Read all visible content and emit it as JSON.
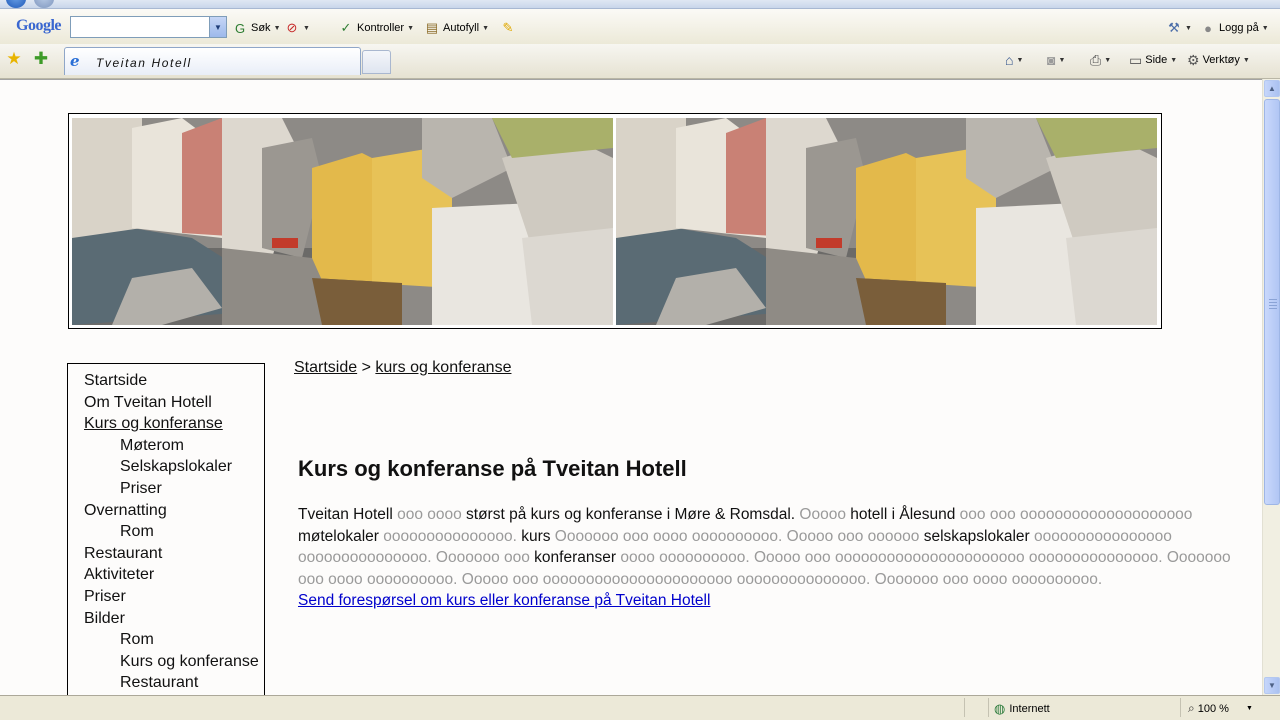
{
  "browser": {
    "google_logo": "Google",
    "google_toolbar": {
      "search_value": "",
      "search_label": "Søk",
      "check_label": "Kontroller",
      "autofill_label": "Autofyll",
      "login_label": "Logg på"
    },
    "tab": {
      "title": "Tveitan Hotell"
    },
    "command_bar": {
      "page_label": "Side",
      "tools_label": "Verktøy"
    },
    "status": {
      "zone": "Internett",
      "zoom": "100 %"
    }
  },
  "site": {
    "nav": [
      {
        "label": "Startside",
        "level": 1,
        "current": false
      },
      {
        "label": "Om Tveitan Hotell",
        "level": 1,
        "current": false
      },
      {
        "label": "Kurs og konferanse",
        "level": 1,
        "current": true
      },
      {
        "label": "Møterom",
        "level": 2,
        "current": false
      },
      {
        "label": "Selskapslokaler",
        "level": 2,
        "current": false
      },
      {
        "label": "Priser",
        "level": 2,
        "current": false
      },
      {
        "label": "Overnatting",
        "level": 1,
        "current": false
      },
      {
        "label": "Rom",
        "level": 2,
        "current": false
      },
      {
        "label": "Restaurant",
        "level": 1,
        "current": false
      },
      {
        "label": "Aktiviteter",
        "level": 1,
        "current": false
      },
      {
        "label": "Priser",
        "level": 1,
        "current": false
      },
      {
        "label": "Bilder",
        "level": 1,
        "current": false
      },
      {
        "label": "Rom",
        "level": 2,
        "current": false
      },
      {
        "label": "Kurs og konferanse",
        "level": 2,
        "current": false
      },
      {
        "label": "Restaurant",
        "level": 2,
        "current": false
      }
    ],
    "breadcrumb": {
      "home": "Startside",
      "separator": ">",
      "current": "kurs og konferanse"
    },
    "title": "Kurs og konferanse på Tveitan Hotell",
    "paragraph": [
      {
        "text": "Tveitan Hotell",
        "filler": false
      },
      {
        "text": " ooo oooo ",
        "filler": true
      },
      {
        "text": "størst på kurs og konferanse i Møre & Romsdal.",
        "filler": false
      },
      {
        "text": " Ooooo ",
        "filler": true
      },
      {
        "text": "hotell i Ålesund",
        "filler": false
      },
      {
        "text": " ooo ooo oooooooooooooooooooo ",
        "filler": true
      },
      {
        "text": "møtelokaler",
        "filler": false
      },
      {
        "text": " ooooooooooooooo. ",
        "filler": true
      },
      {
        "text": "kurs",
        "filler": false
      },
      {
        "text": " Ooooooo ooo oooo oooooooooo. Ooooo ooo oooooo ",
        "filler": true
      },
      {
        "text": "selskapslokaler",
        "filler": false
      },
      {
        "text": " oooooooooooooooo ooooooooooooooo. Ooooooo ooo ",
        "filler": true
      },
      {
        "text": "konferanser",
        "filler": false
      },
      {
        "text": " oooo oooooooooo. Ooooo ooo oooooooooooooooooooooo ooooooooooooooo. Ooooooo ooo oooo oooooooooo. Ooooo ooo oooooooooooooooooooooo ooooooooooooooo. Ooooooo ooo oooo oooooooooo.",
        "filler": true
      }
    ],
    "request_link": "Send forespørsel om kurs eller konferanse på Tveitan Hotell"
  }
}
